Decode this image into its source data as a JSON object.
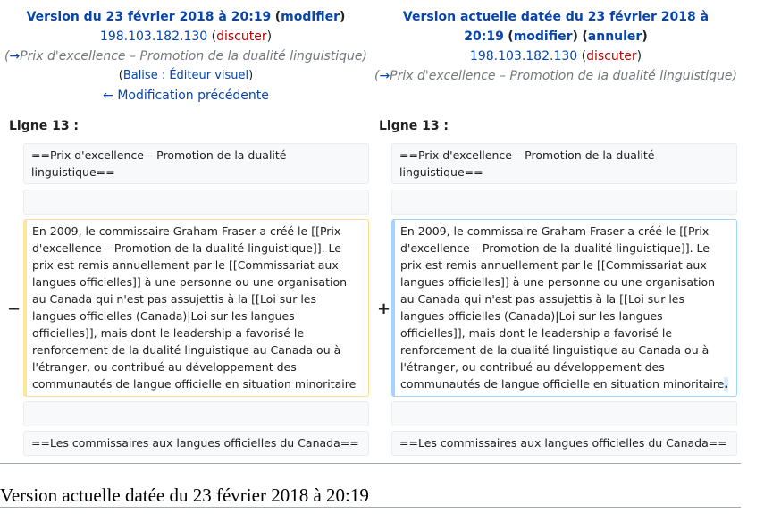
{
  "old": {
    "title": "Version du 23 février 2018 à 20:19",
    "edit_label": "modifier",
    "user": "198.103.182.130",
    "talk_label": "discuter",
    "summary_arrow": "→",
    "summary": "Prix d'excellence – Promotion de la dualité linguistique",
    "tag_prefix": "Balise : ",
    "tag": "Éditeur visuel",
    "prev_link": "← Modification précédente",
    "line_label": "Ligne 13 :"
  },
  "new": {
    "title": "Version actuelle datée du 23 février 2018 à 20:19",
    "edit_label": "modifier",
    "undo_label": "annuler",
    "user": "198.103.182.130",
    "talk_label": "discuter",
    "summary_arrow": "→",
    "summary": "Prix d'excellence – Promotion de la dualité linguistique",
    "line_label": "Ligne 13 :"
  },
  "diff": {
    "context1": "==Prix d'excellence – Promotion de la dualité linguistique==",
    "context3": "==Les commissaires aux langues officielles du Canada==",
    "minus": "−",
    "plus": "+",
    "removed": "En 2009, le commissaire Graham Fraser a créé le [[Prix d'excellence – Promotion de la dualité linguistique]]. Le prix est remis annuellement par le [[Commissariat aux langues officielles]] à une personne ou une organisation au Canada qui n'est pas assujettis à la [[Loi sur les langues officielles (Canada)|Loi sur les langues officielles]], mais dont le leadership a favorisé  le renforcement de la dualité linguistique au Canada ou à l'étranger, ou contribué au développement des communautés de langue officielle en situation minoritaire",
    "added": "En 2009, le commissaire Graham Fraser a créé le [[Prix d'excellence – Promotion de la dualité linguistique]]. Le prix est remis annuellement par le [[Commissariat aux langues officielles]] à une personne ou une organisation au Canada qui n'est pas assujettis à la [[Loi sur les langues officielles (Canada)|Loi sur les langues officielles]], mais dont le leadership a favorisé  le renforcement de la dualité linguistique au Canada ou à l'étranger, ou contribué au développement des communautés de langue officielle en situation minoritaire",
    "added_char": "."
  },
  "footer_title": "Version actuelle datée du 23 février 2018 à 20:19"
}
